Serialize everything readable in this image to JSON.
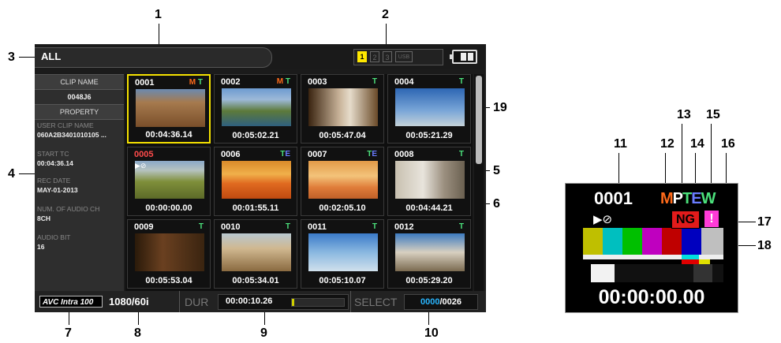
{
  "topbar": {
    "filter": "ALL",
    "slots": [
      "1",
      "2",
      "3",
      "USB"
    ],
    "active_slot": "1"
  },
  "sidebar": {
    "clip_name_label": "CLIP NAME",
    "clip_name": "0048J6",
    "property_label": "PROPERTY",
    "props": [
      {
        "label": "USER CLIP NAME",
        "value": "060A2B3401010105 ..."
      },
      {
        "label": "START TC",
        "value": "00:04:36.14"
      },
      {
        "label": "REC DATE",
        "value": "MAY-01-2013"
      },
      {
        "label": "NUM. OF AUDIO CH",
        "value": "8CH"
      },
      {
        "label": "AUDIO BIT",
        "value": "16"
      }
    ]
  },
  "clips": [
    {
      "no": "0001",
      "flags": [
        {
          "t": "M",
          "c": "#ff6a1a"
        },
        {
          "t": " T",
          "c": "#4be07b"
        }
      ],
      "tc": "00:04:36.14",
      "selected": true,
      "scene": "street"
    },
    {
      "no": "0002",
      "flags": [
        {
          "t": "M",
          "c": "#ff6a1a"
        },
        {
          "t": " T",
          "c": "#4be07b"
        }
      ],
      "tc": "00:05:02.21",
      "scene": "coast"
    },
    {
      "no": "0003",
      "flags": [
        {
          "t": "T",
          "c": "#4be07b"
        }
      ],
      "tc": "00:05:47.04",
      "scene": "person"
    },
    {
      "no": "0004",
      "flags": [
        {
          "t": "T",
          "c": "#4be07b"
        }
      ],
      "tc": "00:05:21.29",
      "scene": "sky"
    },
    {
      "no": "0005",
      "no_color": "#ff4b4b",
      "warn": "▶⊘",
      "flags": [],
      "tc": "00:00:00.00",
      "scene": "field"
    },
    {
      "no": "0006",
      "flags": [
        {
          "t": "T",
          "c": "#4be07b"
        },
        {
          "t": "E",
          "c": "#6a7cff"
        }
      ],
      "tc": "00:01:55.11",
      "scene": "sunset"
    },
    {
      "no": "0007",
      "flags": [
        {
          "t": "T",
          "c": "#4be07b"
        },
        {
          "t": "E",
          "c": "#6a7cff"
        }
      ],
      "tc": "00:02:05.10",
      "scene": "sunset2"
    },
    {
      "no": "0008",
      "flags": [
        {
          "t": "T",
          "c": "#4be07b"
        }
      ],
      "tc": "00:04:44.21",
      "scene": "alley"
    },
    {
      "no": "0009",
      "flags": [
        {
          "t": "T",
          "c": "#4be07b"
        }
      ],
      "tc": "00:05:53.04",
      "scene": "room"
    },
    {
      "no": "0010",
      "flags": [
        {
          "t": "T",
          "c": "#4be07b"
        }
      ],
      "tc": "00:05:34.01",
      "scene": "street2"
    },
    {
      "no": "0011",
      "flags": [
        {
          "t": "T",
          "c": "#4be07b"
        }
      ],
      "tc": "00:05:10.07",
      "scene": "sky2"
    },
    {
      "no": "0012",
      "flags": [
        {
          "t": "T",
          "c": "#4be07b"
        }
      ],
      "tc": "00:05:29.20",
      "scene": "town"
    }
  ],
  "bottombar": {
    "codec_logo": "AVC Intra 100",
    "format": "1080/60i",
    "dur_label": "DUR",
    "duration": "00:00:10.26",
    "duration_progress": 0.04,
    "select_label": "SELECT",
    "selected_count": "0000",
    "total": "/0026"
  },
  "inset": {
    "clip_no": "0001",
    "flags": [
      {
        "t": "M",
        "c": "#ff6a1a"
      },
      {
        "t": "P",
        "c": "#ffffff"
      },
      {
        "t": "T",
        "c": "#4be07b"
      },
      {
        "t": "E",
        "c": "#6a7cff"
      },
      {
        "t": "W",
        "c": "#4be07b"
      }
    ],
    "play_icon": "▶⊘",
    "ng": "NG",
    "exclaim": "!",
    "tc": "00:00:00.00"
  },
  "callouts": [
    "1",
    "2",
    "3",
    "4",
    "5",
    "6",
    "7",
    "8",
    "9",
    "10",
    "11",
    "12",
    "13",
    "14",
    "15",
    "16",
    "17",
    "18",
    "19"
  ]
}
